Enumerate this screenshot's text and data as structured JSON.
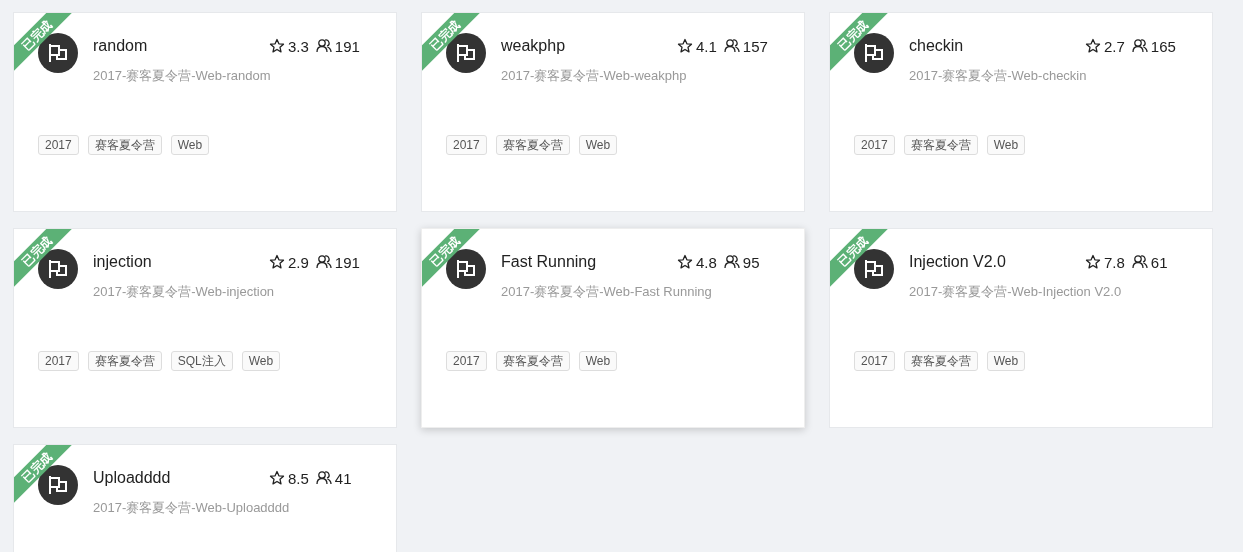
{
  "challenges": [
    {
      "title": "random",
      "rating": "3.3",
      "solvers": "191",
      "subtitle": "2017-赛客夏令营-Web-random",
      "completed": true,
      "ribbon": "已完成",
      "hovered": false,
      "tags": [
        "2017",
        "赛客夏令营",
        "Web"
      ]
    },
    {
      "title": "weakphp",
      "rating": "4.1",
      "solvers": "157",
      "subtitle": "2017-赛客夏令营-Web-weakphp",
      "completed": true,
      "ribbon": "已完成",
      "hovered": false,
      "tags": [
        "2017",
        "赛客夏令营",
        "Web"
      ]
    },
    {
      "title": "checkin",
      "rating": "2.7",
      "solvers": "165",
      "subtitle": "2017-赛客夏令营-Web-checkin",
      "completed": true,
      "ribbon": "已完成",
      "hovered": false,
      "tags": [
        "2017",
        "赛客夏令营",
        "Web"
      ]
    },
    {
      "title": "injection",
      "rating": "2.9",
      "solvers": "191",
      "subtitle": "2017-赛客夏令营-Web-injection",
      "completed": true,
      "ribbon": "已完成",
      "hovered": false,
      "tags": [
        "2017",
        "赛客夏令营",
        "SQL注入",
        "Web"
      ]
    },
    {
      "title": "Fast Running",
      "rating": "4.8",
      "solvers": "95",
      "subtitle": "2017-赛客夏令营-Web-Fast Running",
      "completed": true,
      "ribbon": "已完成",
      "hovered": true,
      "tags": [
        "2017",
        "赛客夏令营",
        "Web"
      ]
    },
    {
      "title": "Injection V2.0",
      "rating": "7.8",
      "solvers": "61",
      "subtitle": "2017-赛客夏令营-Web-Injection V2.0",
      "completed": true,
      "ribbon": "已完成",
      "hovered": false,
      "tags": [
        "2017",
        "赛客夏令营",
        "Web"
      ]
    },
    {
      "title": "Uploadddd",
      "rating": "8.5",
      "solvers": "41",
      "subtitle": "2017-赛客夏令营-Web-Uploadddd",
      "completed": true,
      "ribbon": "已完成",
      "hovered": false
    }
  ]
}
